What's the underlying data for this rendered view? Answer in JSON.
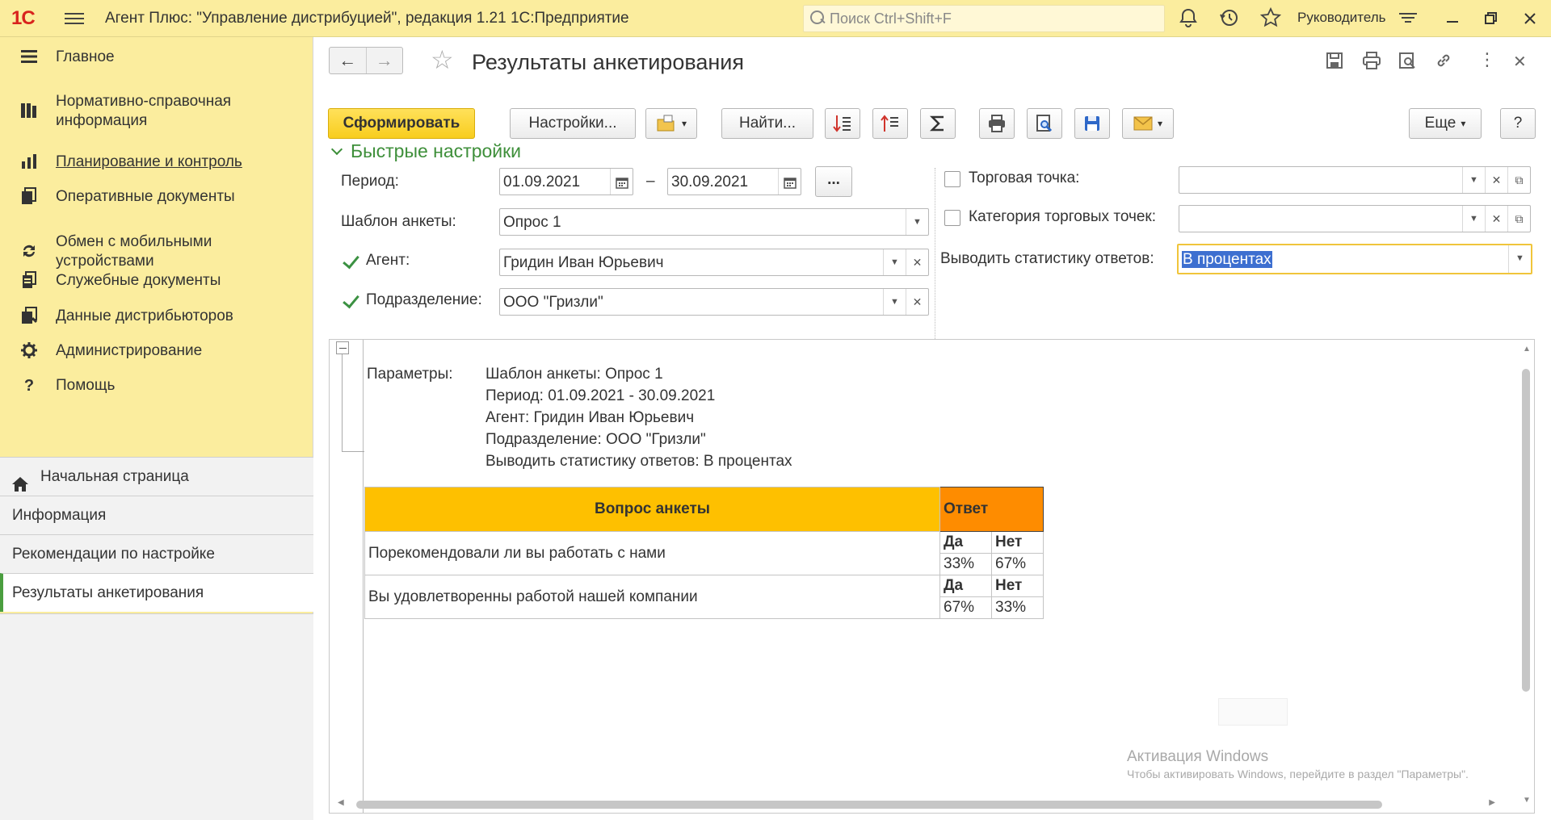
{
  "app": {
    "logo": "1С",
    "title": "Агент Плюс: \"Управление дистрибуцией\", редакция 1.21 1С:Предприятие",
    "search_placeholder": "Поиск Ctrl+Shift+F",
    "user": "Руководитель"
  },
  "sidebar": {
    "sections": [
      {
        "label": "Главное",
        "icon": "menu-lines-icon"
      },
      {
        "label": "Нормативно-справочная информация",
        "icon": "library-icon"
      },
      {
        "label": "Планирование и контроль",
        "icon": "bar-chart-icon"
      },
      {
        "label": "Оперативные документы",
        "icon": "documents-icon"
      },
      {
        "label": "Обмен с мобильными устройствами",
        "icon": "sync-icon"
      },
      {
        "label": "Служебные документы",
        "icon": "service-docs-icon"
      },
      {
        "label": "Данные дистрибьюторов",
        "icon": "distributor-data-icon"
      },
      {
        "label": "Администрирование",
        "icon": "gear-icon"
      },
      {
        "label": "Помощь",
        "icon": "question-icon"
      }
    ],
    "open_windows": [
      {
        "label": "Начальная страница"
      },
      {
        "label": "Информация"
      },
      {
        "label": "Рекомендации по настройке"
      },
      {
        "label": "Результаты анкетирования"
      }
    ]
  },
  "form": {
    "title": "Результаты анкетирования",
    "toolbar": {
      "generate": "Сформировать",
      "settings": "Настройки...",
      "find": "Найти...",
      "more": "Еще",
      "help": "?"
    },
    "quick_settings": {
      "title": "Быстрые настройки",
      "period_label": "Период:",
      "period_from": "01.09.2021",
      "period_dash": "–",
      "period_to": "30.09.2021",
      "period_more": "...",
      "template_label": "Шаблон анкеты:",
      "template_value": "Опрос 1",
      "agent_label": "Агент:",
      "agent_value": "Гридин Иван Юрьевич",
      "agent_checked": true,
      "dept_label": "Подразделение:",
      "dept_value": "ООО \"Гризли\"",
      "dept_checked": true,
      "outlet_label": "Торговая точка:",
      "outlet_value": "",
      "outlet_checked": false,
      "outlet_cat_label": "Категория торговых точек:",
      "outlet_cat_value": "",
      "outlet_cat_checked": false,
      "stats_label": "Выводить статистику ответов:",
      "stats_value": "В процентах"
    }
  },
  "report": {
    "params_label": "Параметры:",
    "params": [
      "Шаблон анкеты: Опрос 1",
      "Период: 01.09.2021 - 30.09.2021",
      "Агент: Гридин Иван Юрьевич",
      "Подразделение: ООО \"Гризли\"",
      "Выводить статистику ответов: В процентах"
    ],
    "table": {
      "header_question": "Вопрос анкеты",
      "header_answer": "Ответ",
      "rows": [
        {
          "question": "Порекомендовали ли вы работать с нами",
          "opt1": "Да",
          "opt2": "Нет",
          "val1": "33%",
          "val2": "67%"
        },
        {
          "question": "Вы удовлетворенны работой нашей компании",
          "opt1": "Да",
          "opt2": "Нет",
          "val1": "67%",
          "val2": "33%"
        }
      ]
    }
  },
  "watermark": {
    "line1": "Активация Windows",
    "line2": "Чтобы активировать Windows, перейдите в раздел \"Параметры\"."
  },
  "colors": {
    "topbar": "#fbed9e",
    "accent_green": "#3e8f3a",
    "primary_button": "#f8cd1e",
    "header_question": "#fec000",
    "header_answer": "#fe8c00",
    "selection": "#3d6fd0"
  }
}
